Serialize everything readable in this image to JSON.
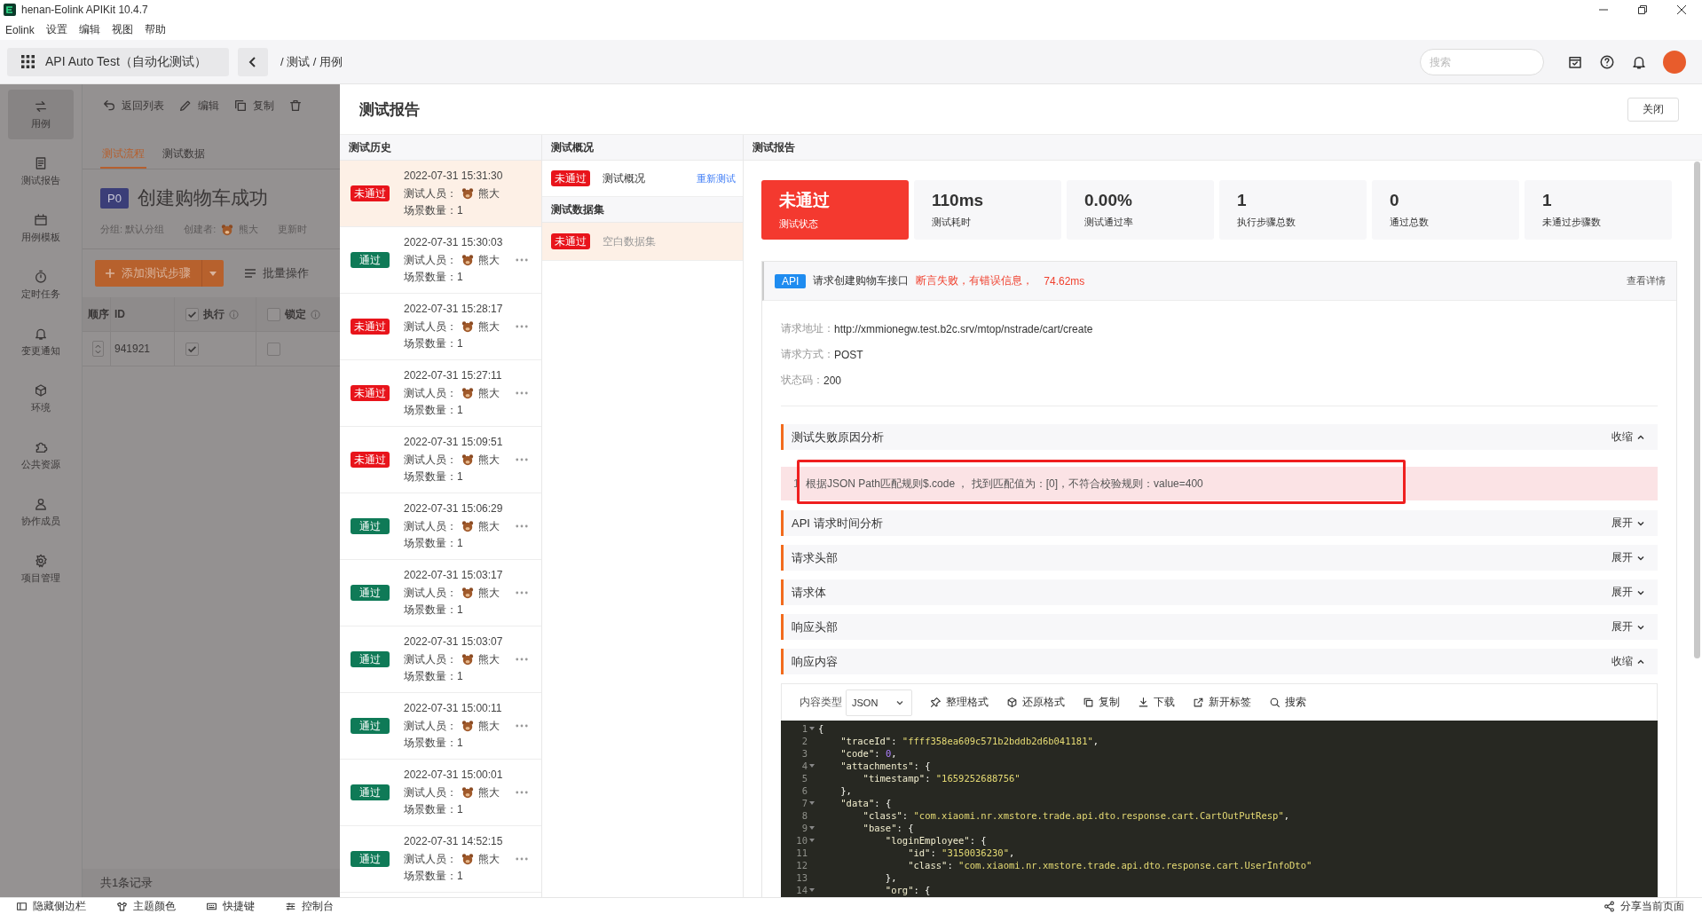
{
  "window": {
    "title": "henan-Eolink APIKit 10.4.7"
  },
  "menu": [
    {
      "label": "Eolink"
    },
    {
      "label": "设置"
    },
    {
      "label": "编辑"
    },
    {
      "label": "视图"
    },
    {
      "label": "帮助"
    }
  ],
  "topbar": {
    "project": "API Auto Test（自动化测试）",
    "breadcrumb": "/ 测试 / 用例",
    "search": {
      "placeholder": "搜索"
    }
  },
  "sidebar": {
    "items": [
      {
        "label": "用例",
        "kind": "swap",
        "selected": true
      },
      {
        "label": "测试报告",
        "kind": "document",
        "selected": false
      },
      {
        "label": "用例模板",
        "kind": "folder",
        "selected": false
      },
      {
        "label": "定时任务",
        "kind": "stopwatch",
        "selected": false
      },
      {
        "label": "变更通知",
        "kind": "bell",
        "selected": false
      },
      {
        "label": "环境",
        "kind": "cube",
        "selected": false
      },
      {
        "label": "公共资源",
        "kind": "puzzle",
        "selected": false
      },
      {
        "label": "协作成员",
        "kind": "person",
        "selected": false
      },
      {
        "label": "项目管理",
        "kind": "gear",
        "selected": false
      }
    ]
  },
  "case_panel": {
    "actions": [
      {
        "label": "返回列表",
        "kind": "undo"
      },
      {
        "label": "编辑",
        "kind": "pencil"
      },
      {
        "label": "复制",
        "kind": "copy"
      },
      {
        "kind": "trash"
      }
    ],
    "tabs": [
      {
        "label": "测试流程",
        "selected": true
      },
      {
        "label": "测试数据",
        "selected": false
      }
    ],
    "priority": "P0",
    "title": "创建购物车成功",
    "meta": [
      {
        "label": "分组: 默认分组"
      },
      {
        "label": "创建者:",
        "user": "熊大"
      },
      {
        "label": "更新时"
      }
    ],
    "add_button": "添加测试步骤",
    "batch_button": "批量操作",
    "table": {
      "columns": [
        {
          "label": "顺序"
        },
        {
          "label": "ID"
        },
        {
          "label": "执行",
          "checked": true
        },
        {
          "label": "锁定",
          "checked": false
        }
      ],
      "rows": [
        {
          "id": "941921",
          "execute": true,
          "locked": false
        }
      ]
    },
    "footer": "共1条记录"
  },
  "report": {
    "title": "测试报告",
    "close": "关闭",
    "history": {
      "title": "测试历史",
      "items": [
        {
          "passed": false,
          "status_label": "未通过",
          "time": "2022-07-31 15:31:30",
          "tester_label": "测试人员：",
          "tester": "熊大",
          "scene_label": "场景数量：",
          "scenes": "1",
          "has_menu": false,
          "selected": true
        },
        {
          "passed": true,
          "status_label": "通过",
          "time": "2022-07-31 15:30:03",
          "tester_label": "测试人员：",
          "tester": "熊大",
          "scene_label": "场景数量：",
          "scenes": "1",
          "has_menu": true,
          "selected": false
        },
        {
          "passed": false,
          "status_label": "未通过",
          "time": "2022-07-31 15:28:17",
          "tester_label": "测试人员：",
          "tester": "熊大",
          "scene_label": "场景数量：",
          "scenes": "1",
          "has_menu": true,
          "selected": false
        },
        {
          "passed": false,
          "status_label": "未通过",
          "time": "2022-07-31 15:27:11",
          "tester_label": "测试人员：",
          "tester": "熊大",
          "scene_label": "场景数量：",
          "scenes": "1",
          "has_menu": true,
          "selected": false
        },
        {
          "passed": false,
          "status_label": "未通过",
          "time": "2022-07-31 15:09:51",
          "tester_label": "测试人员：",
          "tester": "熊大",
          "scene_label": "场景数量：",
          "scenes": "1",
          "has_menu": true,
          "selected": false
        },
        {
          "passed": true,
          "status_label": "通过",
          "time": "2022-07-31 15:06:29",
          "tester_label": "测试人员：",
          "tester": "熊大",
          "scene_label": "场景数量：",
          "scenes": "1",
          "has_menu": true,
          "selected": false
        },
        {
          "passed": true,
          "status_label": "通过",
          "time": "2022-07-31 15:03:17",
          "tester_label": "测试人员：",
          "tester": "熊大",
          "scene_label": "场景数量：",
          "scenes": "1",
          "has_menu": true,
          "selected": false
        },
        {
          "passed": true,
          "status_label": "通过",
          "time": "2022-07-31 15:03:07",
          "tester_label": "测试人员：",
          "tester": "熊大",
          "scene_label": "场景数量：",
          "scenes": "1",
          "has_menu": true,
          "selected": false
        },
        {
          "passed": true,
          "status_label": "通过",
          "time": "2022-07-31 15:00:11",
          "tester_label": "测试人员：",
          "tester": "熊大",
          "scene_label": "场景数量：",
          "scenes": "1",
          "has_menu": true,
          "selected": false
        },
        {
          "passed": true,
          "status_label": "通过",
          "time": "2022-07-31 15:00:01",
          "tester_label": "测试人员：",
          "tester": "熊大",
          "scene_label": "场景数量：",
          "scenes": "1",
          "has_menu": true,
          "selected": false
        },
        {
          "passed": true,
          "status_label": "通过",
          "time": "2022-07-31 14:52:15",
          "tester_label": "测试人员：",
          "tester": "熊大",
          "scene_label": "场景数量：",
          "scenes": "1",
          "has_menu": true,
          "selected": false
        }
      ]
    },
    "overview": {
      "title": "测试概况",
      "summary": {
        "passed": false,
        "status_label": "未通过",
        "label": "测试概况",
        "action": "重新测试"
      },
      "datasets_title": "测试数据集",
      "datasets": [
        {
          "passed": false,
          "status_label": "未通过",
          "label": "空白数据集",
          "selected": true
        }
      ]
    },
    "detail": {
      "title": "测试报告",
      "cards": [
        {
          "kind": "status",
          "value": "未通过",
          "label": "测试状态"
        },
        {
          "kind": "metric",
          "value": "110ms",
          "label": "测试耗时"
        },
        {
          "kind": "metric",
          "value": "0.00%",
          "label": "测试通过率"
        },
        {
          "kind": "metric",
          "value": "1",
          "label": "执行步骤总数"
        },
        {
          "kind": "metric",
          "value": "0",
          "label": "通过总数"
        },
        {
          "kind": "metric",
          "value": "1",
          "label": "未通过步骤数"
        }
      ],
      "step": {
        "badge": "API",
        "name": "请求创建购物车接口",
        "message": "断言失败，有错误信息，",
        "duration": "74.62ms",
        "link": "查看详情",
        "fields": [
          {
            "label": "请求地址：",
            "value": "http://xmmionegw.test.b2c.srv/mtop/nstrade/cart/create"
          },
          {
            "label": "请求方式：",
            "value": "POST"
          },
          {
            "label": "状态码：",
            "value": "200"
          }
        ],
        "sections": [
          {
            "title": "测试失败原因分析",
            "toggle": "收缩",
            "expanded": true,
            "failures": [
              {
                "index": "1",
                "text": "根据JSON Path匹配规则$.code ， 找到匹配值为：[0]，不符合校验规则：value=400",
                "highlighted": true
              }
            ]
          },
          {
            "title": "API 请求时间分析",
            "toggle": "展开",
            "expanded": false
          },
          {
            "title": "请求头部",
            "toggle": "展开",
            "expanded": false
          },
          {
            "title": "请求体",
            "toggle": "展开",
            "expanded": false
          },
          {
            "title": "响应头部",
            "toggle": "展开",
            "expanded": false
          },
          {
            "title": "响应内容",
            "toggle": "收缩",
            "expanded": true,
            "response": {
              "type_label": "内容类型",
              "type": "JSON",
              "tools": [
                {
                  "label": "整理格式",
                  "kind": "pin"
                },
                {
                  "label": "还原格式",
                  "kind": "cube"
                },
                {
                  "label": "复制",
                  "kind": "copy"
                },
                {
                  "label": "下载",
                  "kind": "download"
                },
                {
                  "label": "新开标签",
                  "kind": "external-link"
                },
                {
                  "label": "搜索",
                  "kind": "search"
                }
              ],
              "lines": [
                {
                  "num": "1",
                  "text": "{",
                  "fold": true
                },
                {
                  "num": "2",
                  "text": "    \"traceId\": \"ffff358ea609c571b2bddb2d6b041181\",",
                  "fold": false
                },
                {
                  "num": "3",
                  "text": "    \"code\": 0,",
                  "fold": false
                },
                {
                  "num": "4",
                  "text": "    \"attachments\": {",
                  "fold": true
                },
                {
                  "num": "5",
                  "text": "        \"timestamp\": \"1659252688756\"",
                  "fold": false
                },
                {
                  "num": "6",
                  "text": "    },",
                  "fold": false
                },
                {
                  "num": "7",
                  "text": "    \"data\": {",
                  "fold": true
                },
                {
                  "num": "8",
                  "text": "        \"class\": \"com.xiaomi.nr.xmstore.trade.api.dto.response.cart.CartOutPutResp\",",
                  "fold": false
                },
                {
                  "num": "9",
                  "text": "        \"base\": {",
                  "fold": true
                },
                {
                  "num": "10",
                  "text": "            \"loginEmployee\": {",
                  "fold": true
                },
                {
                  "num": "11",
                  "text": "                \"id\": \"3150036230\",",
                  "fold": false
                },
                {
                  "num": "12",
                  "text": "                \"class\": \"com.xiaomi.nr.xmstore.trade.api.dto.response.cart.UserInfoDto\"",
                  "fold": false
                },
                {
                  "num": "13",
                  "text": "            },",
                  "fold": false
                },
                {
                  "num": "14",
                  "text": "            \"org\": {",
                  "fold": true
                }
              ]
            }
          }
        ]
      }
    }
  },
  "statusbar": {
    "items": [
      {
        "label": "隐藏侧边栏",
        "kind": "sidebar"
      },
      {
        "label": "主题颜色",
        "kind": "shirt"
      },
      {
        "label": "快捷键",
        "kind": "keyboard"
      },
      {
        "label": "控制台",
        "kind": "sliders"
      }
    ],
    "share": {
      "label": "分享当前页面",
      "kind": "share"
    }
  }
}
